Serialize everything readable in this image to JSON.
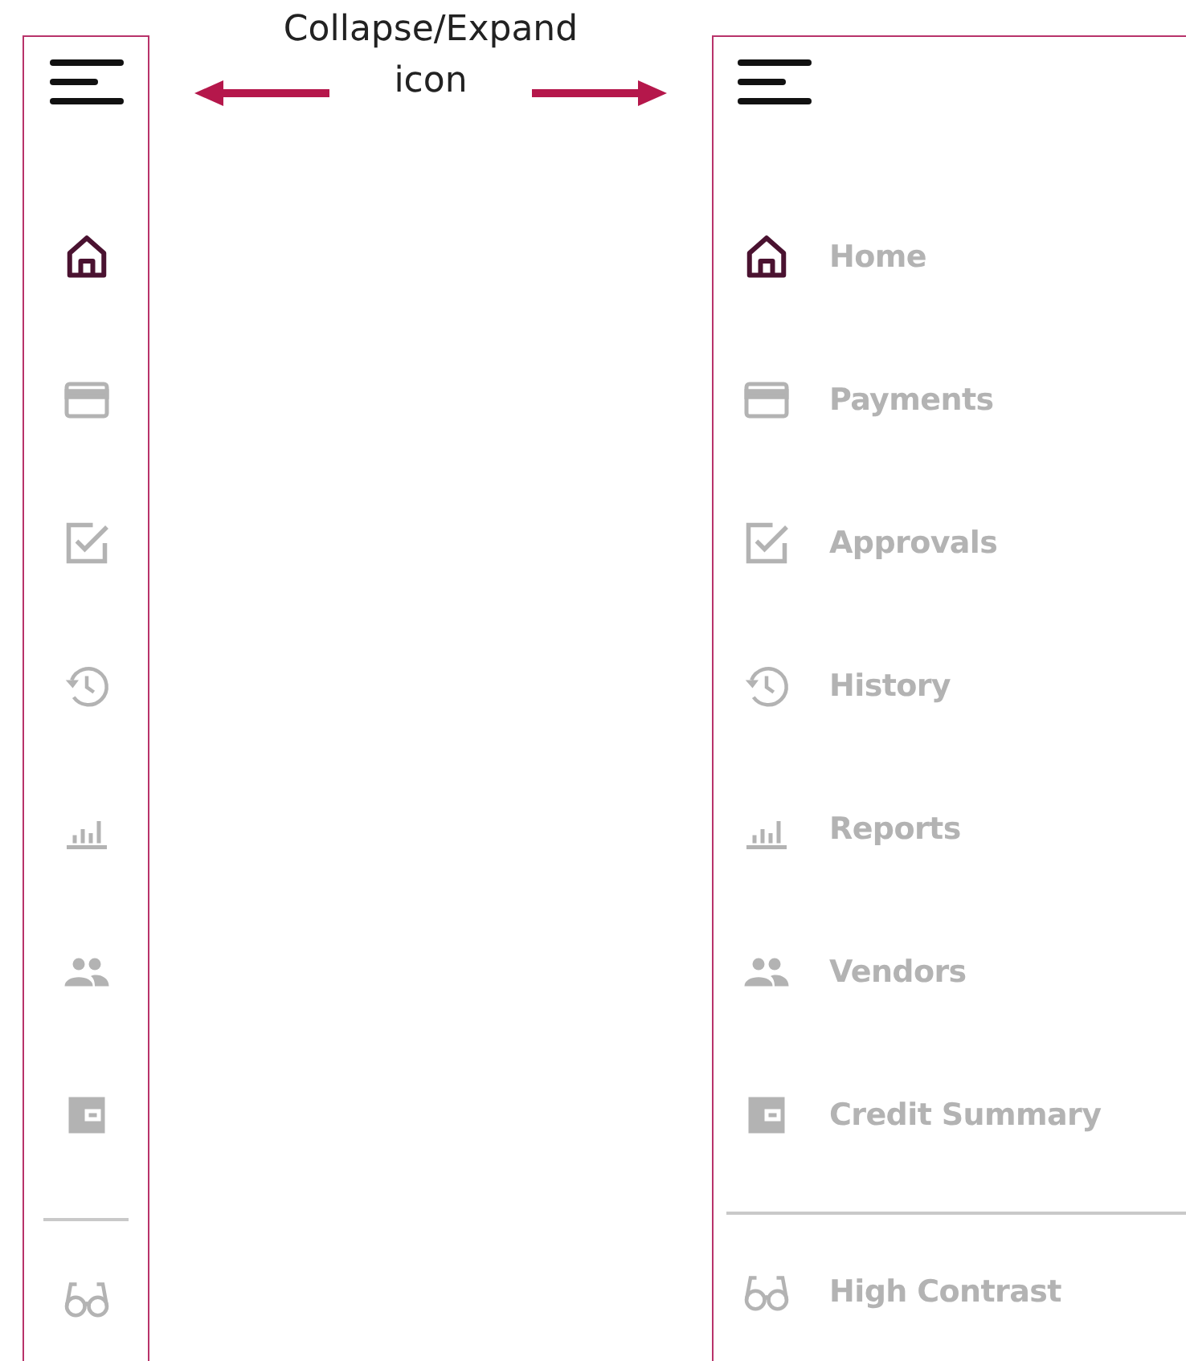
{
  "annotation": {
    "lines": [
      "Collapse/Expand",
      "icon"
    ]
  },
  "collapsed_sidebar": {
    "items": [
      {
        "kind": "home",
        "selected": true
      },
      {
        "kind": "card",
        "selected": false
      },
      {
        "kind": "check",
        "selected": false
      },
      {
        "kind": "history",
        "selected": false
      },
      {
        "kind": "chart",
        "selected": false
      },
      {
        "kind": "people",
        "selected": false
      },
      {
        "kind": "wallet",
        "selected": false
      }
    ],
    "footer_items": [
      {
        "kind": "glasses",
        "selected": false
      }
    ]
  },
  "expanded_sidebar": {
    "items": [
      {
        "kind": "home",
        "label": "Home",
        "selected": true
      },
      {
        "kind": "card",
        "label": "Payments",
        "selected": false
      },
      {
        "kind": "check",
        "label": "Approvals",
        "selected": false
      },
      {
        "kind": "history",
        "label": "History",
        "selected": false
      },
      {
        "kind": "chart",
        "label": "Reports",
        "selected": false
      },
      {
        "kind": "people",
        "label": "Vendors",
        "selected": false
      },
      {
        "kind": "wallet",
        "label": "Credit Summary",
        "selected": false
      }
    ],
    "footer_items": [
      {
        "kind": "glasses",
        "label": "High Contrast",
        "selected": false
      }
    ]
  }
}
